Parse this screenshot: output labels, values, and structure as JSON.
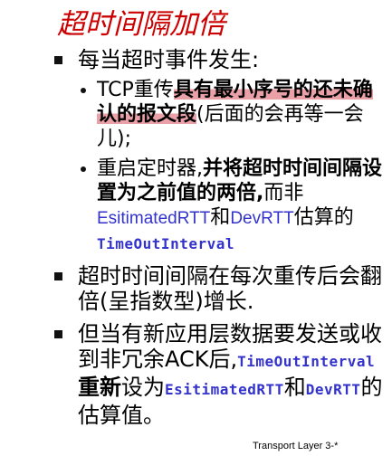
{
  "title": "超时间隔加倍",
  "bullets": [
    {
      "text": "每当超时事件发生:",
      "subs": [
        {
          "p1": "TCP重传",
          "p2_hl": "具有最小序号的还未确认的报文段",
          "p3": "(后面的会再等一会儿);"
        },
        {
          "p1": "重启定时器,",
          "p2_bold": "并将超时时间间隔设置为之前值的两倍,",
          "p3": "而非",
          "p4_blue": "EsitimatedRTT",
          "p5": "和",
          "p6_blue": "DevRTT",
          "p7": "估算的",
          "p8_mono": "TimeOutInterval"
        }
      ]
    },
    {
      "text": "超时时间间隔在每次重传后会翻倍(呈指数型)增长."
    },
    {
      "p1": "但当有新应用层数据要发送或收到非冗余ACK后,",
      "p2_mono": "TimeOutInterval",
      "p3_bold": "重新",
      "p4": "设为",
      "p5_mono": "EsitimatedRTT",
      "p6": "和",
      "p7_mono": "DevRTT",
      "p8": "的估算值。"
    }
  ],
  "footer": "Transport Layer 3-*",
  "colors": {
    "title": "#cc0000",
    "highlight": "#e9a0a7",
    "code": "#3333cc"
  }
}
